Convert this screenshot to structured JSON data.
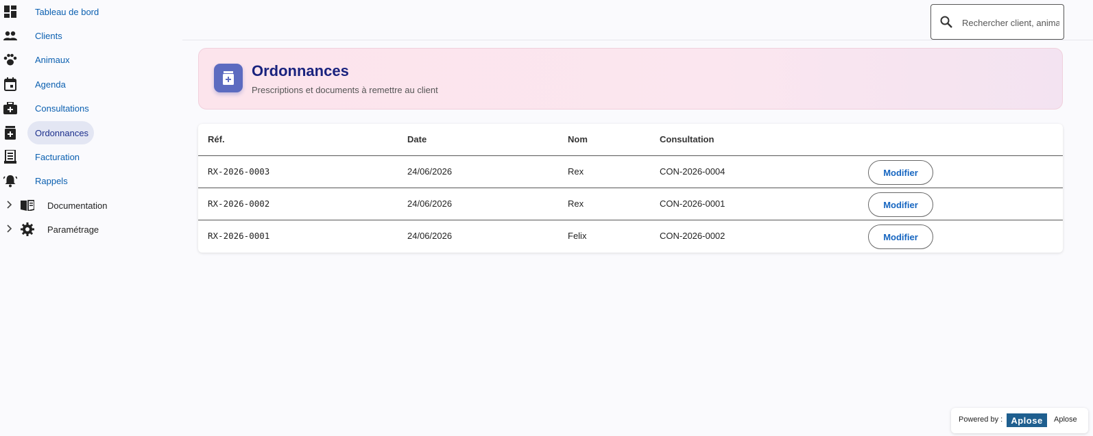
{
  "sidebar": {
    "items": [
      {
        "label": "Tableau de bord",
        "icon": "dashboard-icon"
      },
      {
        "label": "Clients",
        "icon": "people-icon"
      },
      {
        "label": "Animaux",
        "icon": "paw-icon"
      },
      {
        "label": "Agenda",
        "icon": "calendar-icon"
      },
      {
        "label": "Consultations",
        "icon": "medical-bag-icon"
      },
      {
        "label": "Ordonnances",
        "icon": "medication-icon",
        "active": true
      },
      {
        "label": "Facturation",
        "icon": "receipt-icon"
      },
      {
        "label": "Rappels",
        "icon": "bell-icon"
      }
    ],
    "groups": [
      {
        "label": "Documentation",
        "icon": "book-icon"
      },
      {
        "label": "Paramétrage",
        "icon": "gear-icon"
      }
    ]
  },
  "search": {
    "placeholder": "Rechercher client, animal, c"
  },
  "header": {
    "title": "Ordonnances",
    "subtitle": "Prescriptions et documents à remettre au client"
  },
  "table": {
    "columns": [
      "Réf.",
      "Date",
      "Nom",
      "Consultation"
    ],
    "rows": [
      {
        "ref": "RX-2026-0003",
        "date": "24/06/2026",
        "nom": "Rex",
        "consultation": "CON-2026-0004",
        "action": "Modifier"
      },
      {
        "ref": "RX-2026-0002",
        "date": "24/06/2026",
        "nom": "Rex",
        "consultation": "CON-2026-0001",
        "action": "Modifier"
      },
      {
        "ref": "RX-2026-0001",
        "date": "24/06/2026",
        "nom": "Felix",
        "consultation": "CON-2026-0002",
        "action": "Modifier"
      }
    ]
  },
  "footer": {
    "powered_label": "Powered by :",
    "logo_text": "Aplose",
    "brand_name": "Aplose"
  },
  "colors": {
    "accent": "#5c6bc0",
    "title": "#1a237e",
    "link": "#0a5fb0"
  }
}
